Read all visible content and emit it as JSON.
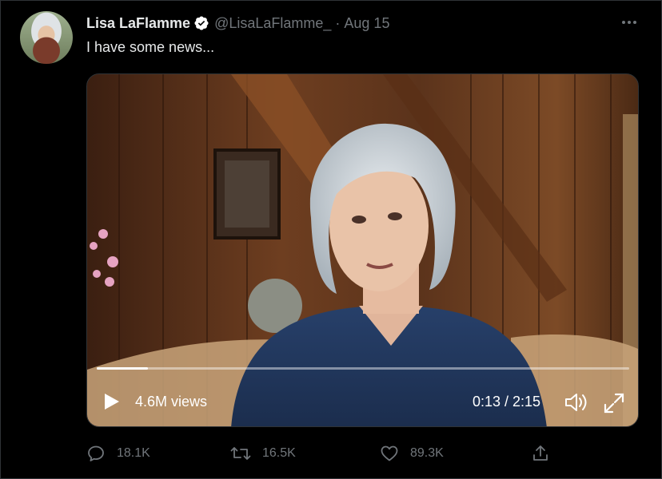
{
  "tweet": {
    "author_name": "Lisa LaFlamme",
    "handle": "@LisaLaFlamme_",
    "separator": "·",
    "date": "Aug 15",
    "text": "I have some news...",
    "more_icon": "more-horizontal-icon",
    "verified_icon": "verified-badge-icon",
    "verified_color": "#ffffff"
  },
  "video": {
    "views": "4.6M views",
    "time": "0:13 / 2:15",
    "progress": 0.096,
    "play_icon": "play-icon",
    "volume_icon": "volume-icon",
    "fullscreen_icon": "fullscreen-icon"
  },
  "actions": {
    "replies": "18.1K",
    "retweets": "16.5K",
    "likes": "89.3K",
    "reply_icon": "reply-icon",
    "retweet_icon": "retweet-icon",
    "like_icon": "heart-icon",
    "share_icon": "share-icon"
  },
  "colors": {
    "background": "#000000",
    "text_primary": "#e7e9ea",
    "text_secondary": "#71767b",
    "border": "#2f3336"
  }
}
